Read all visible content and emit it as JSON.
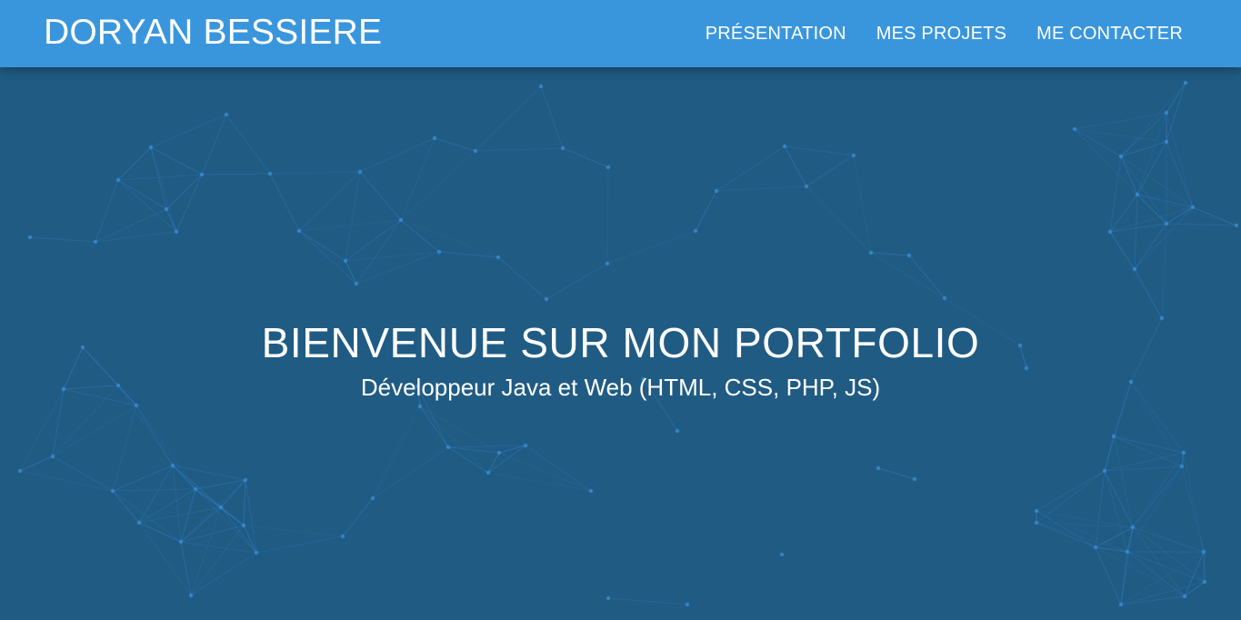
{
  "header": {
    "brand": "DORYAN BESSIERE",
    "nav": [
      {
        "label": "PRÉSENTATION"
      },
      {
        "label": "MES PROJETS"
      },
      {
        "label": "ME CONTACTER"
      }
    ]
  },
  "hero": {
    "title": "BIENVENUE SUR MON PORTFOLIO",
    "subtitle": "Développeur Java et Web (HTML, CSS, PHP, JS)"
  },
  "colors": {
    "navbar": "#3a96dc",
    "background": "#205b84",
    "network": "#3b8fd9",
    "text": "#ffffff"
  }
}
